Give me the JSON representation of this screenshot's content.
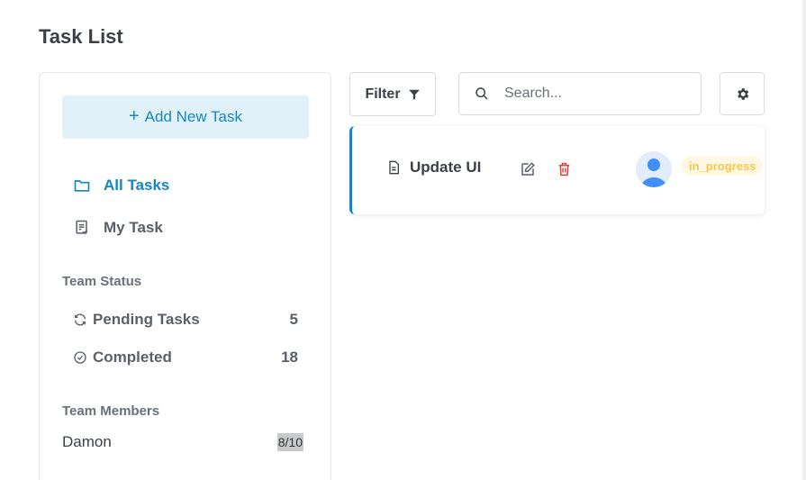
{
  "page": {
    "title": "Task List"
  },
  "sidebar": {
    "add_button_label": "Add New Task",
    "nav": [
      {
        "label": "All Tasks",
        "icon": "folder-icon",
        "active": true
      },
      {
        "label": "My Task",
        "icon": "task-list-icon",
        "active": false
      }
    ],
    "team_status": {
      "title": "Team Status",
      "items": [
        {
          "label": "Pending Tasks",
          "count": "5",
          "icon": "sync-icon"
        },
        {
          "label": "Completed",
          "count": "18",
          "icon": "check-circle-icon"
        }
      ]
    },
    "team_members": {
      "title": "Team Members",
      "items": [
        {
          "name": "Damon",
          "score": "8/10"
        }
      ]
    }
  },
  "toolbar": {
    "filter_label": "Filter",
    "search_placeholder": "Search...",
    "settings_icon": "gear-icon"
  },
  "tasks": [
    {
      "title": "Update UI",
      "status": "in_progress"
    }
  ],
  "colors": {
    "accent": "#1486c6",
    "delete": "#e53935",
    "status_text": "#f4c94a",
    "status_bg": "#fdf7e3"
  }
}
